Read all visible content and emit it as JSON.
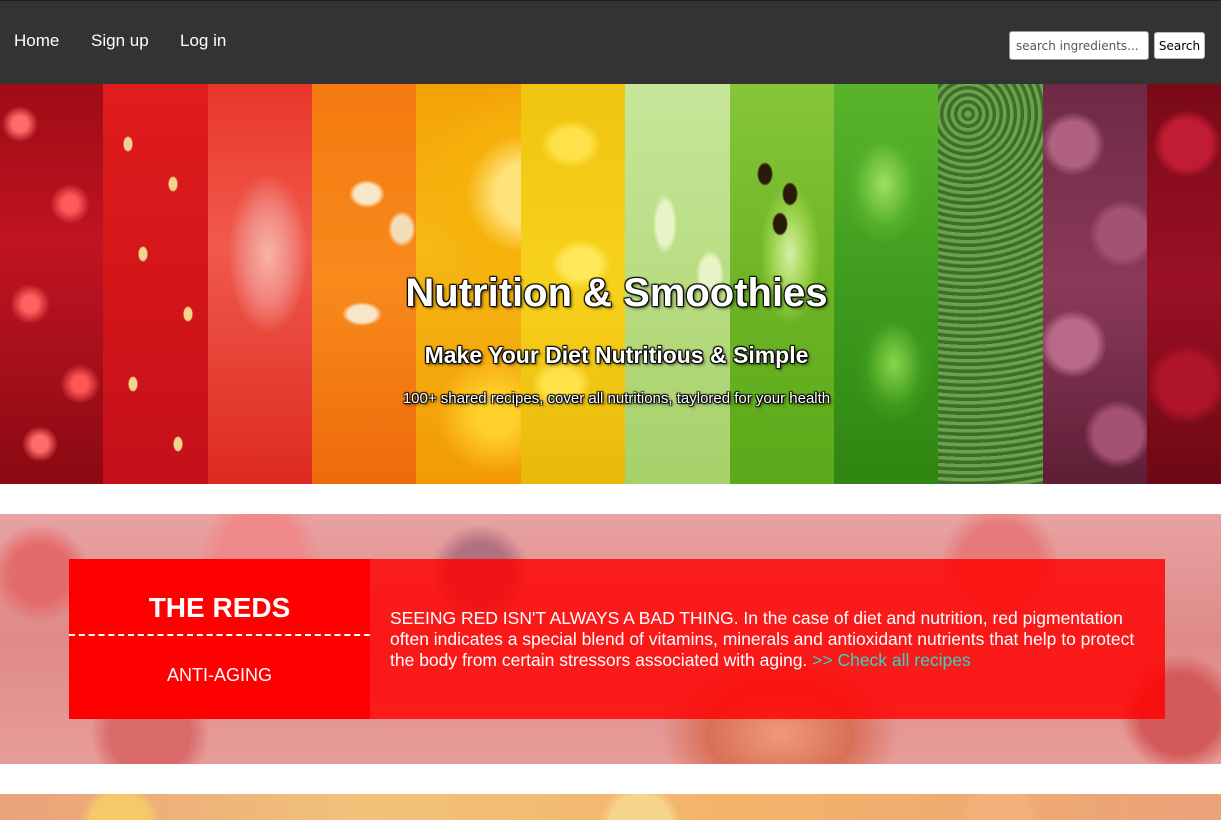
{
  "nav": {
    "links": [
      "Home",
      "Sign up",
      "Log in"
    ],
    "search_placeholder": "search ingredients...",
    "search_button": "Search"
  },
  "hero": {
    "title": "Nutrition & Smoothies",
    "subtitle": "Make Your Diet Nutritious & Simple",
    "tagline": "100+ shared recipes, cover all nutritions, taylored for your health"
  },
  "reds": {
    "title": "THE REDS",
    "tag": "ANTI-AGING",
    "description": "SEEING RED ISN'T ALWAYS A BAD THING. In the case of diet and nutrition, red pigmentation often indicates a special blend of vitamins, minerals and antioxidant nutrients that help to protect the body from certain stressors associated with aging. ",
    "link": ">> Check all recipes"
  },
  "colors": {
    "navbar": "#333333",
    "reds_accent": "#ff0000",
    "link": "#3ed1c2"
  }
}
